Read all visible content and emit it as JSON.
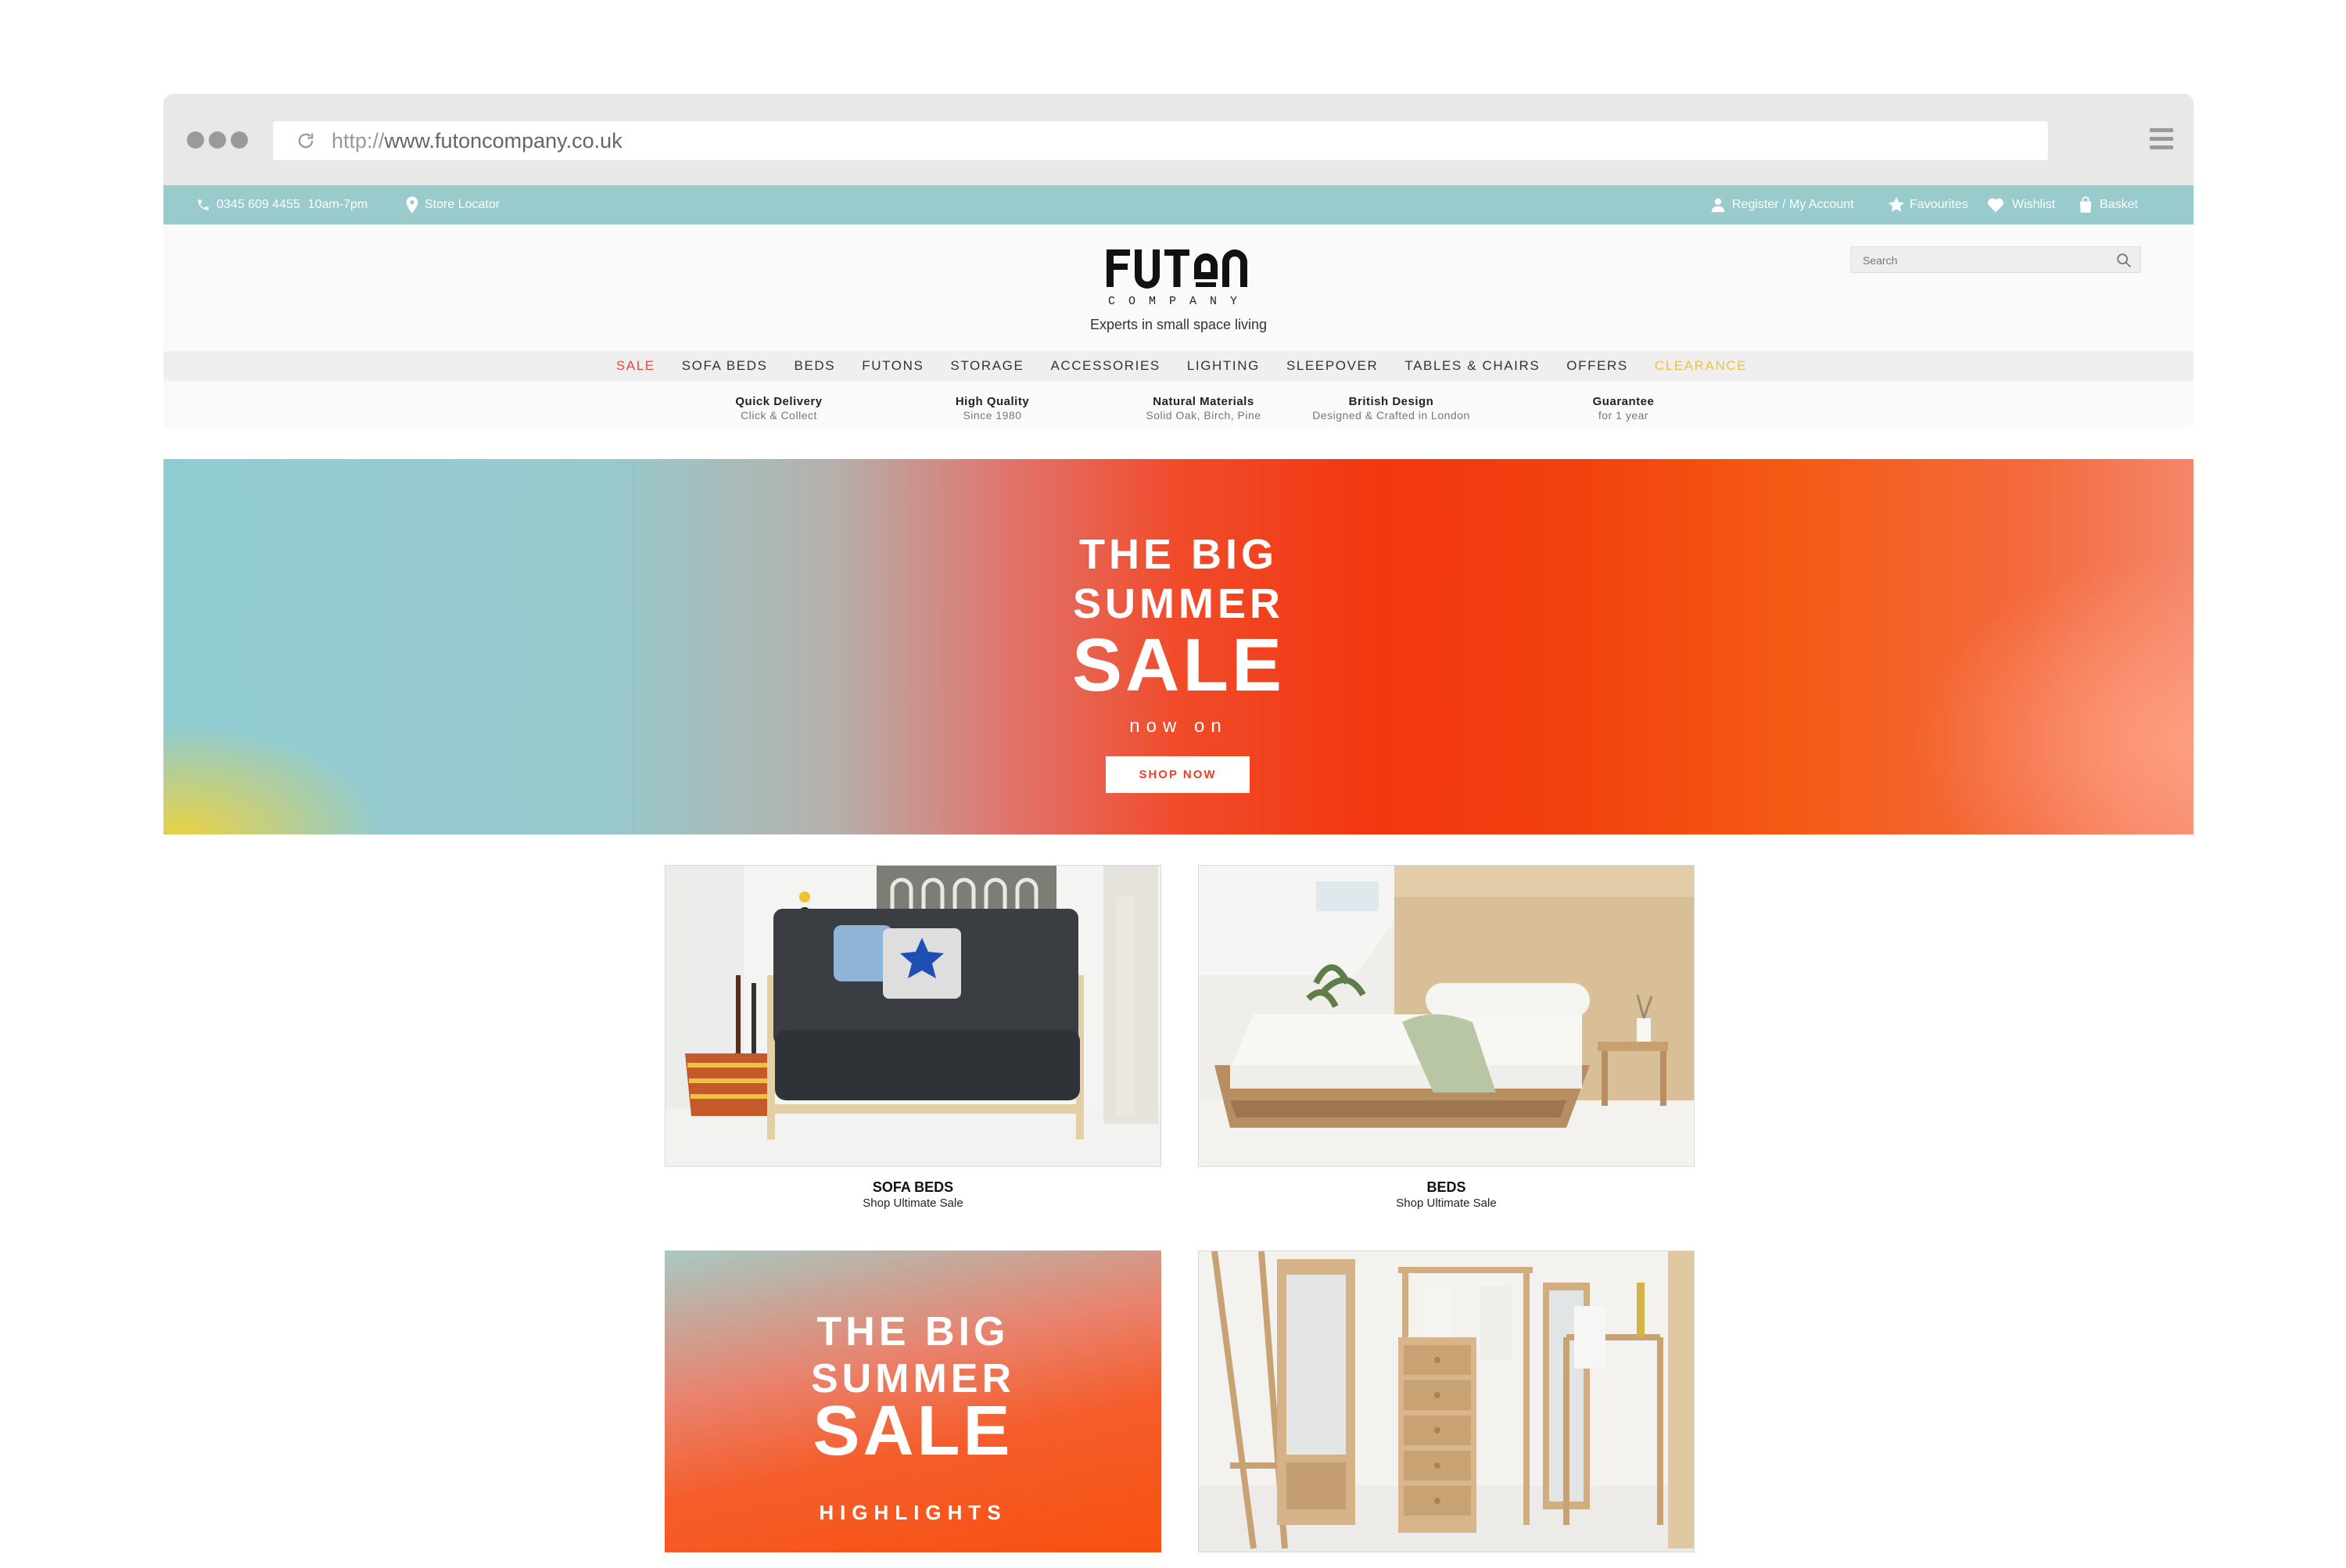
{
  "browser": {
    "url_protocol": "http://",
    "url_host": "www.futoncompany.co.uk"
  },
  "topbar": {
    "phone": "0345 609 4455",
    "hours": "10am-7pm",
    "store_locator": "Store Locator",
    "account": "Register / My Account",
    "favourites": "Favourites",
    "wishlist": "Wishlist",
    "basket": "Basket"
  },
  "header": {
    "logo": "FUTON",
    "logo_sub": "COMPANY",
    "tagline": "Experts in small space living",
    "search_placeholder": "Search"
  },
  "nav": {
    "items": [
      {
        "label": "SALE",
        "color": "#e8463c"
      },
      {
        "label": "SOFA BEDS",
        "color": "#333333"
      },
      {
        "label": "BEDS",
        "color": "#333333"
      },
      {
        "label": "FUTONS",
        "color": "#333333"
      },
      {
        "label": "STORAGE",
        "color": "#333333"
      },
      {
        "label": "ACCESSORIES",
        "color": "#333333"
      },
      {
        "label": "LIGHTING",
        "color": "#333333"
      },
      {
        "label": "SLEEPOVER",
        "color": "#333333"
      },
      {
        "label": "TABLES & CHAIRS",
        "color": "#333333"
      },
      {
        "label": "OFFERS",
        "color": "#333333"
      },
      {
        "label": "CLEARANCE",
        "color": "#f0c040"
      }
    ]
  },
  "usps": [
    {
      "title": "Quick Delivery",
      "sub": "Click & Collect"
    },
    {
      "title": "High Quality",
      "sub": "Since 1980"
    },
    {
      "title": "Natural Materials",
      "sub": "Solid Oak, Birch, Pine"
    },
    {
      "title": "British Design",
      "sub": "Designed & Crafted in London"
    },
    {
      "title": "Guarantee",
      "sub": "for 1 year"
    }
  ],
  "hero": {
    "line1": "THE BIG",
    "line2": "SUMMER",
    "line3": "SALE",
    "sub": "now on",
    "button": "SHOP NOW"
  },
  "cards": [
    {
      "title": "SOFA BEDS",
      "sub": "Shop Ultimate Sale"
    },
    {
      "title": "BEDS",
      "sub": "Shop Ultimate Sale"
    }
  ],
  "promo": {
    "line1": "THE BIG",
    "line2": "SUMMER",
    "line3": "SALE",
    "line4": "HIGHLIGHTS"
  },
  "colors": {
    "topbar": "#99cacc",
    "sale": "#e8463c",
    "clearance": "#f0c040",
    "hero_orange": "#f3360f",
    "hero_teal": "#8fccd2"
  }
}
